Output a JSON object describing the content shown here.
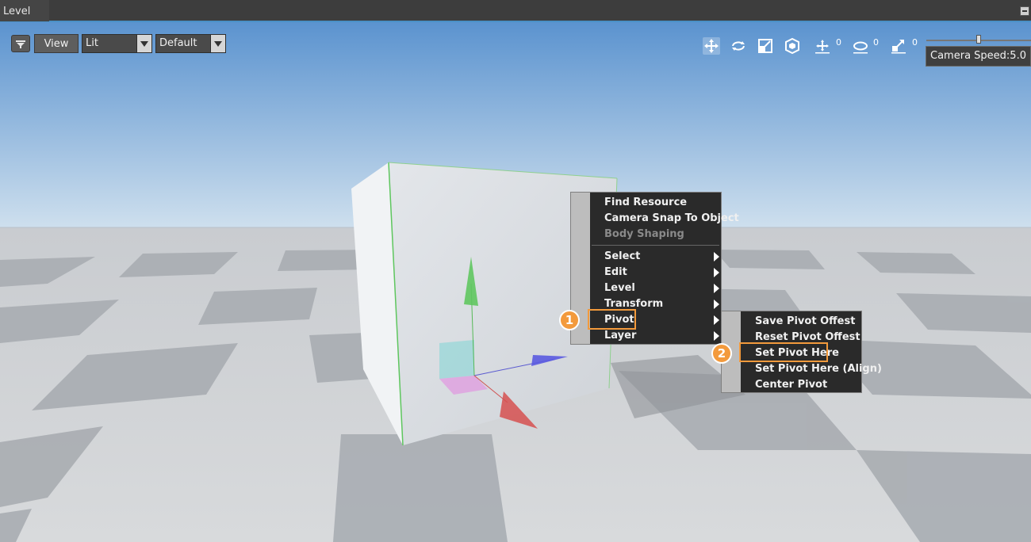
{
  "window": {
    "tab_title": "Level"
  },
  "toolbar": {
    "view_label": "View",
    "shading_mode": "Lit",
    "layout_mode": "Default",
    "tools": [
      {
        "icon": "move-icon",
        "active": true
      },
      {
        "icon": "rotate-icon",
        "active": false
      },
      {
        "icon": "scale-icon",
        "active": false
      },
      {
        "icon": "local-global-icon",
        "active": false
      },
      {
        "icon": "move-snap-icon",
        "count": "0"
      },
      {
        "icon": "rotate-snap-icon",
        "count": "0"
      },
      {
        "icon": "scale-snap-icon",
        "count": "0"
      }
    ],
    "camera_speed_label": "Camera Speed:5.0",
    "camera_speed_fraction": 0.5
  },
  "context_menu": {
    "items": [
      {
        "label": "Find Resource"
      },
      {
        "label": "Camera Snap To Object"
      },
      {
        "label": "Body Shaping",
        "disabled": true
      },
      {
        "label": "Select",
        "submenu": true
      },
      {
        "label": "Edit",
        "submenu": true
      },
      {
        "label": "Level",
        "submenu": true
      },
      {
        "label": "Transform",
        "submenu": true
      },
      {
        "label": "Pivot",
        "submenu": true
      },
      {
        "label": "Layer",
        "submenu": true
      }
    ]
  },
  "pivot_submenu": {
    "items": [
      {
        "label": "Save Pivot Offest"
      },
      {
        "label": "Reset Pivot Offest"
      },
      {
        "label": "Set Pivot Here"
      },
      {
        "label": "Set Pivot Here (Align)"
      },
      {
        "label": "Center Pivot"
      }
    ]
  },
  "annotations": {
    "step1": "1",
    "step2": "2"
  },
  "colors": {
    "highlight": "#f39a3c",
    "sky_top": "#5b93cf",
    "sky_bottom": "#cfe0ee"
  }
}
